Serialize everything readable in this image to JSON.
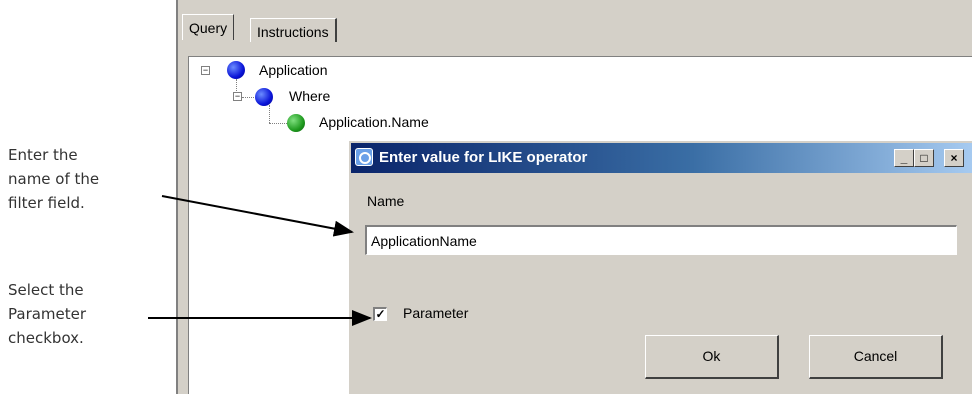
{
  "annotations": {
    "name_hint": "Enter the\nname of the\nfilter field.",
    "param_hint": "Select the\nParameter\ncheckbox."
  },
  "tabs": [
    {
      "label": "Query",
      "active": true
    },
    {
      "label": "Instructions",
      "active": false
    }
  ],
  "tree": {
    "root": {
      "label": "Application",
      "color": "blue"
    },
    "where": {
      "label": "Where",
      "color": "blue"
    },
    "leaf": {
      "label": "Application.Name",
      "color": "green"
    },
    "expander_glyph": "−"
  },
  "dialog": {
    "title": "Enter value for LIKE operator",
    "controls": {
      "minimize": "_",
      "maximize": "□",
      "close": "×"
    },
    "name_label": "Name",
    "name_value": "ApplicationName",
    "parameter_label": "Parameter",
    "parameter_checked": true,
    "check_glyph": "✓",
    "ok_label": "Ok",
    "cancel_label": "Cancel"
  },
  "colors": {
    "window_bg": "#d4d0c8",
    "titlebar_start": "#0a246a",
    "titlebar_end": "#a6caf0",
    "node_blue": "#0a14d8",
    "node_green": "#1f9a1f"
  }
}
